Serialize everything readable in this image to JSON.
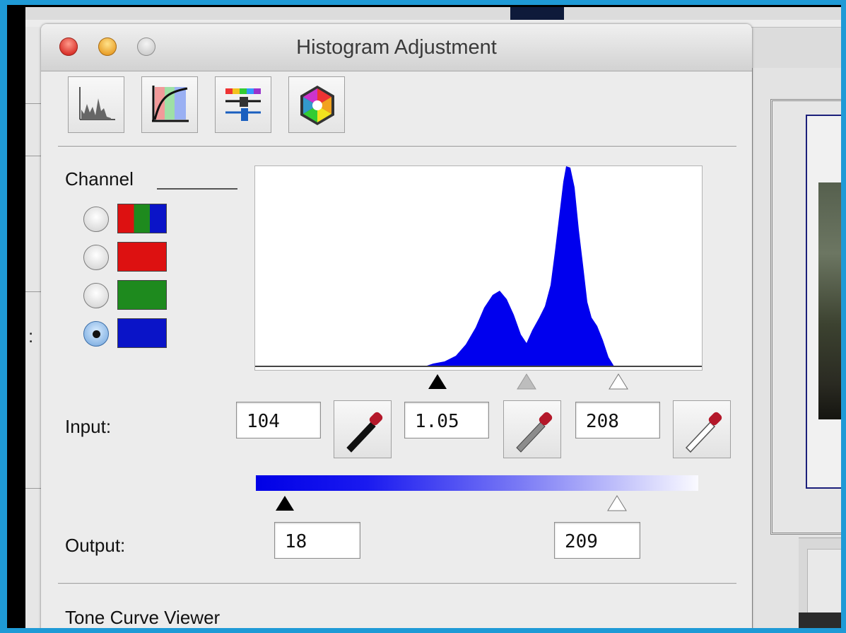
{
  "window": {
    "title": "Histogram Adjustment"
  },
  "toolbar": [
    {
      "icon": "histogram-icon"
    },
    {
      "icon": "tone-curve-icon"
    },
    {
      "icon": "color-balance-icon"
    },
    {
      "icon": "hue-wheel-icon"
    }
  ],
  "channel": {
    "label": "Channel",
    "options": [
      {
        "name": "rgb",
        "colors": [
          "#dd1111",
          "#1e8a1e",
          "#0a14c8"
        ],
        "selected": false
      },
      {
        "name": "red",
        "colors": [
          "#dd1111"
        ],
        "selected": false
      },
      {
        "name": "green",
        "colors": [
          "#1e8a1e"
        ],
        "selected": false
      },
      {
        "name": "blue",
        "colors": [
          "#0a14c8"
        ],
        "selected": true
      }
    ]
  },
  "histogram": {
    "color": "#0000ee",
    "input_markers": {
      "black": 104,
      "gray": 1.05,
      "white": 208
    }
  },
  "input": {
    "label": "Input:",
    "black_value": "104",
    "gamma_value": "1.05",
    "white_value": "208"
  },
  "output": {
    "label": "Output:",
    "black_value": "18",
    "white_value": "209"
  },
  "tone_curve": {
    "label": "Tone Curve Viewer"
  },
  "colors": {
    "accent_border": "#1f9ad6",
    "channel_blue": "#0000ee"
  }
}
